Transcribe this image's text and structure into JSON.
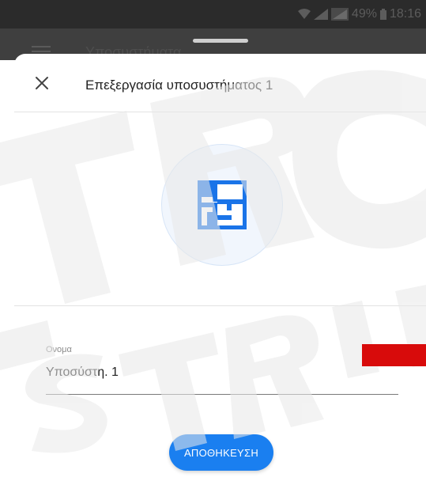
{
  "status_bar": {
    "battery": "49%",
    "time": "18:16"
  },
  "background_app": {
    "title": "Υποσυστήματα"
  },
  "sheet": {
    "title": "Επεξεργασία υποσυστήματος 1",
    "close_icon": "close-icon",
    "subsystem_icon": "floor-plan-icon",
    "name_field": {
      "label": "Ονομα",
      "value": "Υποσύστη. 1"
    },
    "save_label": "ΑΠΟΘΗΚΕΥΣΗ"
  },
  "colors": {
    "accent": "#1a7ff0",
    "brand_red": "#d80b0b"
  }
}
